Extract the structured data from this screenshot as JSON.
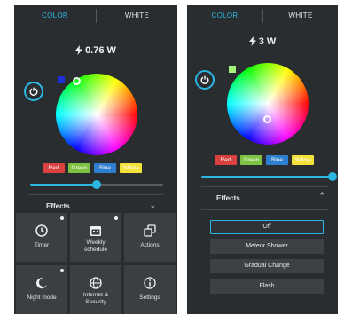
{
  "left": {
    "tabs": [
      "COLOR",
      "WHITE"
    ],
    "power_reading": "0.76 W",
    "chips": [
      "Red",
      "Green",
      "Blue",
      "Yellow"
    ],
    "brightness_pct": 0.5,
    "effects_label": "Effects",
    "tiles": [
      {
        "label": "Timer",
        "icon": "clock-icon",
        "badge": true
      },
      {
        "label": "Weekly\nschedule",
        "icon": "calendar-icon",
        "badge": true
      },
      {
        "label": "Actions",
        "icon": "actions-icon",
        "badge": false
      },
      {
        "label": "Night mode",
        "icon": "moon-icon",
        "badge": true
      },
      {
        "label": "Internet &\nSecurity",
        "icon": "globe-icon",
        "badge": false
      },
      {
        "label": "Settings",
        "icon": "info-icon",
        "badge": false
      }
    ]
  },
  "right": {
    "tabs": [
      "COLOR",
      "WHITE"
    ],
    "power_reading": "3 W",
    "chips": [
      "Red",
      "Green",
      "Blue",
      "Yellow"
    ],
    "brightness_pct": 1.0,
    "effects_label": "Effects",
    "effects_options": [
      "Off",
      "Meteor Shower",
      "Gradual Change",
      "Flash"
    ]
  },
  "colors": {
    "accent": "#2bb7e3",
    "panel": "#2a2d30",
    "chip_red": "#d9413f",
    "chip_green": "#7dc243",
    "chip_blue": "#2f7fd0",
    "chip_yellow": "#f2e23a",
    "left_swatch": "#1e2fd6",
    "right_swatch": "#a4f27a"
  }
}
